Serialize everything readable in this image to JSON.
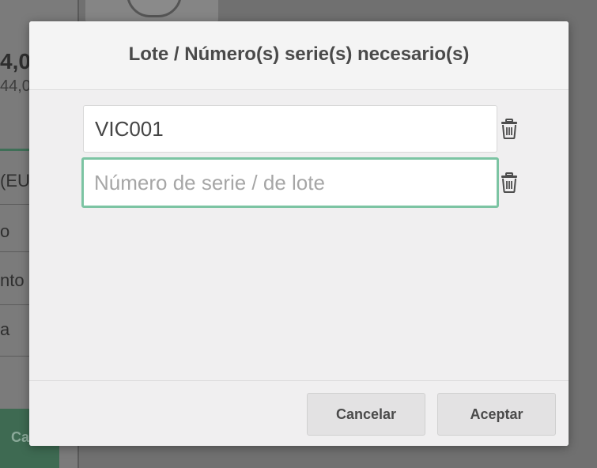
{
  "background": {
    "total_partial": "4,0",
    "total_sub_partial": "44,0",
    "currency_partial": "(EU",
    "row_labels": [
      "o",
      "nto",
      "a"
    ],
    "button_partial": "Ca"
  },
  "dialog": {
    "title": "Lote / Número(s) serie(s) necesario(s)",
    "lots": [
      {
        "value": "VIC001",
        "placeholder": "Número de serie / de lote"
      },
      {
        "value": "",
        "placeholder": "Número de serie / de lote"
      }
    ],
    "cancel_label": "Cancelar",
    "accept_label": "Aceptar"
  },
  "colors": {
    "focus_border": "#7cc4a3",
    "overlay": "#707070"
  },
  "icons": {
    "delete": "trash-icon"
  }
}
